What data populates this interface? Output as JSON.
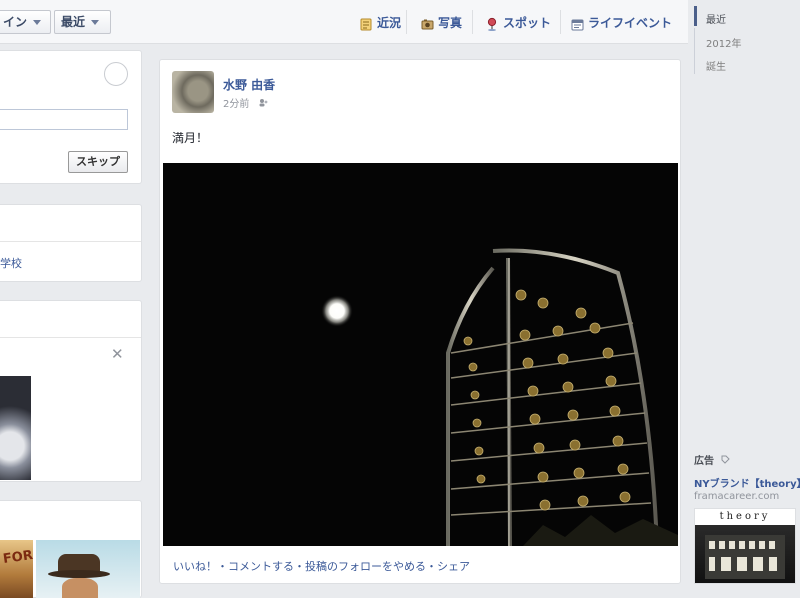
{
  "topbar": {
    "timeline_button": "イン",
    "recent_button": "最近",
    "composer_tabs": [
      {
        "label": "近況",
        "icon": "status-icon"
      },
      {
        "label": "写真",
        "icon": "camera-icon"
      },
      {
        "label": "スポット",
        "icon": "map-pin-icon"
      },
      {
        "label": "ライフイベント",
        "icon": "life-event-icon"
      }
    ]
  },
  "left": {
    "skip_button": "スキップ",
    "school_link": "学校",
    "photo_b_text": "FOR"
  },
  "post": {
    "author": "水野 由香",
    "time": "2分前",
    "post_text": "満月！",
    "actions": "いいね！・コメントする・投稿のフォローをやめる・シェア"
  },
  "timeline_nav": [
    "最近",
    "2012年",
    "誕生"
  ],
  "ad": {
    "heading": "広告",
    "title": "NYブランド【theory】",
    "url": "framacareer.com",
    "logo": "theory"
  },
  "colors": {
    "link": "#3b5998",
    "background": "#e9ebee"
  }
}
